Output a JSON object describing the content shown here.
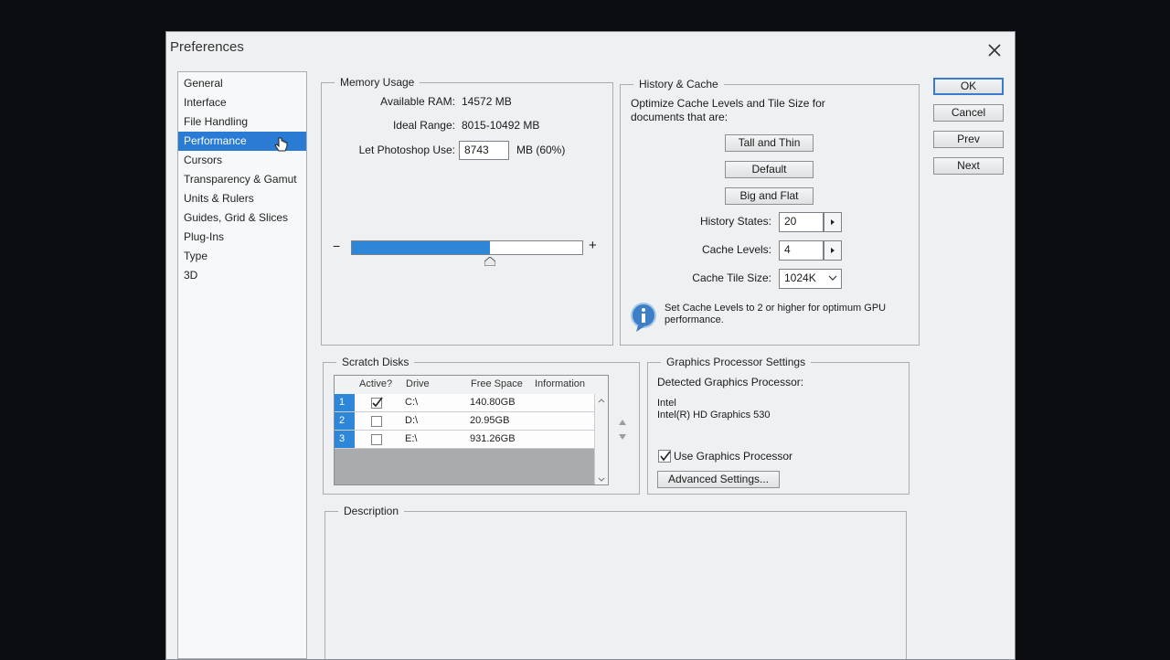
{
  "window": {
    "title": "Preferences"
  },
  "categories": [
    "General",
    "Interface",
    "File Handling",
    "Performance",
    "Cursors",
    "Transparency & Gamut",
    "Units & Rulers",
    "Guides, Grid & Slices",
    "Plug-Ins",
    "Type",
    "3D"
  ],
  "selected_category": "Performance",
  "memory": {
    "legend": "Memory Usage",
    "available_label": "Available RAM:",
    "available_value": "14572 MB",
    "ideal_label": "Ideal Range:",
    "ideal_value": "8015-10492 MB",
    "use_label": "Let Photoshop Use:",
    "use_value": "8743",
    "use_suffix": "MB (60%)",
    "minus": "−",
    "plus": "+",
    "slider_percent": 60
  },
  "history": {
    "legend": "History & Cache",
    "intro": "Optimize Cache Levels and Tile Size for documents that are:",
    "btn_tall": "Tall and Thin",
    "btn_default": "Default",
    "btn_big": "Big and Flat",
    "states_label": "History States:",
    "states_value": "20",
    "levels_label": "Cache Levels:",
    "levels_value": "4",
    "tile_label": "Cache Tile Size:",
    "tile_value": "1024K",
    "info": "Set Cache Levels to 2 or higher for optimum GPU performance."
  },
  "actions": {
    "ok": "OK",
    "cancel": "Cancel",
    "prev": "Prev",
    "next": "Next"
  },
  "scratch": {
    "legend": "Scratch Disks",
    "headers": {
      "active": "Active?",
      "drive": "Drive",
      "free": "Free Space",
      "info": "Information"
    },
    "rows": [
      {
        "num": "1",
        "active": true,
        "drive": "C:\\",
        "free": "140.80GB",
        "info": ""
      },
      {
        "num": "2",
        "active": false,
        "drive": "D:\\",
        "free": "20.95GB",
        "info": ""
      },
      {
        "num": "3",
        "active": false,
        "drive": "E:\\",
        "free": "931.26GB",
        "info": ""
      }
    ]
  },
  "gpu": {
    "legend": "Graphics Processor Settings",
    "detected_label": "Detected Graphics Processor:",
    "vendor": "Intel",
    "model": "Intel(R) HD Graphics 530",
    "use_label": "Use Graphics Processor",
    "use_checked": true,
    "advanced": "Advanced Settings..."
  },
  "description": {
    "legend": "Description"
  },
  "colors": {
    "accent": "#2e86d8",
    "selection": "#2a7bd4",
    "dialog_bg": "#eef0f2"
  }
}
